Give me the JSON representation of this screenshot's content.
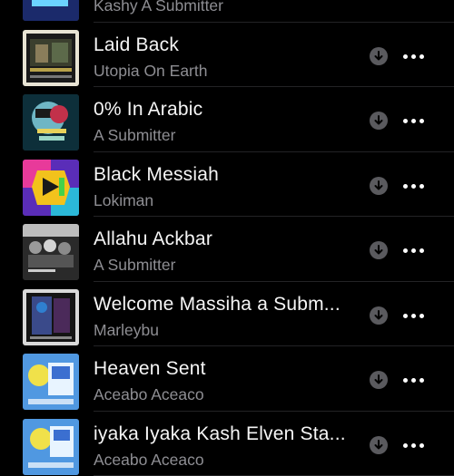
{
  "songs": [
    {
      "title": "",
      "artist": "Kashy A Submitter",
      "art_icon": "album-art-green-blue"
    },
    {
      "title": "Laid Back",
      "artist": "Utopia On Earth",
      "art_icon": "album-art-building"
    },
    {
      "title": "0% In Arabic",
      "artist": "A Submitter",
      "art_icon": "album-art-world-nutshell"
    },
    {
      "title": "Black Messiah",
      "artist": "Lokiman",
      "art_icon": "album-art-colorful-cube"
    },
    {
      "title": "Allahu Ackbar",
      "artist": "A Submitter",
      "art_icon": "album-art-crowd"
    },
    {
      "title": "Welcome Massiha a Subm...",
      "artist": "Marleybu",
      "art_icon": "album-art-dark-figure"
    },
    {
      "title": "Heaven Sent",
      "artist": "Aceabo Aceaco",
      "art_icon": "album-art-blue-swirl"
    },
    {
      "title": "iyaka Iyaka Kash Elven Sta...",
      "artist": "Aceabo Aceaco",
      "art_icon": "album-art-blue-swirl-2"
    }
  ],
  "row_icons": {
    "download": "download-icon",
    "more": "more-options-icon"
  },
  "colors": {
    "background": "#000000",
    "title": "#f5f5f5",
    "subtitle": "#8e8e93",
    "download_circle": "#5a5a5e"
  }
}
